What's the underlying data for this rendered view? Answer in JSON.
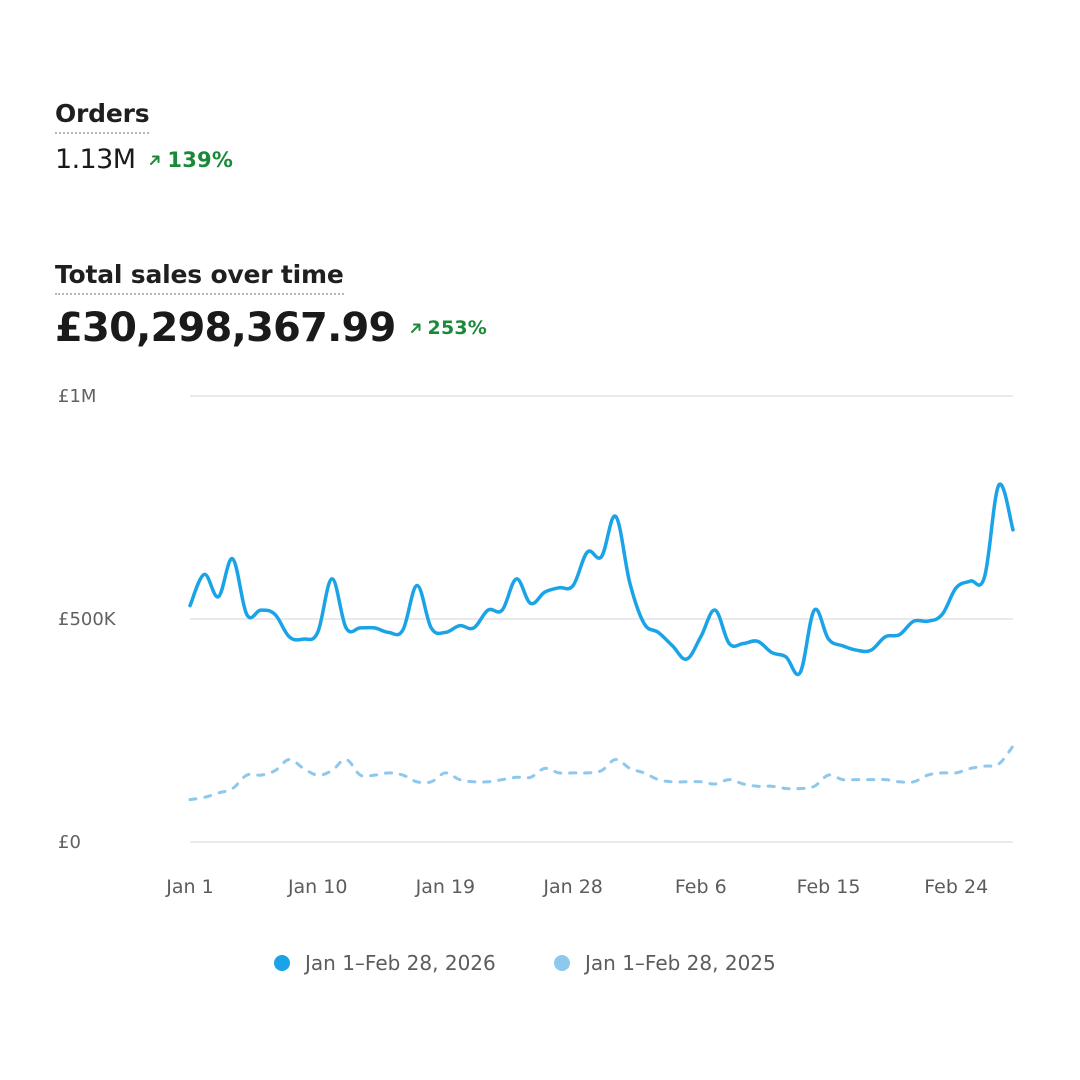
{
  "orders": {
    "label": "Orders",
    "value": "1.13M",
    "change": "139%",
    "trend_color": "#1a8a3a"
  },
  "sales": {
    "label": "Total sales over time",
    "value": "£30,298,367.99",
    "change": "253%",
    "trend_color": "#1a8a3a"
  },
  "chart_data": {
    "type": "line",
    "title": "Total sales over time",
    "y_ticks": [
      "£0",
      "£500K",
      "£1M"
    ],
    "ylim": [
      0,
      1000000
    ],
    "x_tick_labels": [
      "Jan 1",
      "Jan 10",
      "Jan 19",
      "Jan 28",
      "Feb 6",
      "Feb 15",
      "Feb 24"
    ],
    "x_tick_days": [
      1,
      10,
      19,
      28,
      37,
      46,
      55
    ],
    "grid": true,
    "legend_position": "bottom",
    "series": [
      {
        "name": "Jan 1–Feb 28, 2026",
        "color": "#1ba3e8",
        "style": "solid",
        "days": [
          1,
          2,
          3,
          4,
          5,
          6,
          7,
          8,
          9,
          10,
          11,
          12,
          13,
          14,
          15,
          16,
          17,
          18,
          19,
          20,
          21,
          22,
          23,
          24,
          25,
          26,
          27,
          28,
          29,
          30,
          31,
          32,
          33,
          34,
          35,
          36,
          37,
          38,
          39,
          40,
          41,
          42,
          43,
          44,
          45,
          46,
          47,
          48,
          49,
          50,
          51,
          52,
          53,
          54,
          55,
          56,
          57,
          58,
          59
        ],
        "values": [
          530000,
          600000,
          550000,
          635000,
          510000,
          520000,
          510000,
          460000,
          455000,
          470000,
          590000,
          480000,
          480000,
          480000,
          470000,
          475000,
          575000,
          480000,
          470000,
          485000,
          480000,
          520000,
          520000,
          590000,
          535000,
          560000,
          570000,
          575000,
          650000,
          640000,
          730000,
          580000,
          490000,
          470000,
          440000,
          410000,
          460000,
          520000,
          445000,
          445000,
          450000,
          425000,
          415000,
          380000,
          520000,
          455000,
          440000,
          430000,
          430000,
          460000,
          465000,
          495000,
          495000,
          510000,
          570000,
          585000,
          595000,
          800000,
          700000
        ]
      },
      {
        "name": "Jan 1–Feb 28, 2025",
        "color": "#8ec8ec",
        "style": "dashed",
        "days": [
          1,
          2,
          3,
          4,
          5,
          6,
          7,
          8,
          9,
          10,
          11,
          12,
          13,
          14,
          15,
          16,
          17,
          18,
          19,
          20,
          21,
          22,
          23,
          24,
          25,
          26,
          27,
          28,
          29,
          30,
          31,
          32,
          33,
          34,
          35,
          36,
          37,
          38,
          39,
          40,
          41,
          42,
          43,
          44,
          45,
          46,
          47,
          48,
          49,
          50,
          51,
          52,
          53,
          54,
          55,
          56,
          57,
          58,
          59
        ],
        "values": [
          95000,
          100000,
          110000,
          120000,
          150000,
          150000,
          160000,
          185000,
          165000,
          150000,
          160000,
          185000,
          150000,
          150000,
          155000,
          150000,
          135000,
          135000,
          155000,
          140000,
          135000,
          135000,
          140000,
          145000,
          145000,
          165000,
          155000,
          155000,
          155000,
          160000,
          185000,
          165000,
          155000,
          140000,
          135000,
          135000,
          135000,
          130000,
          140000,
          130000,
          125000,
          125000,
          120000,
          120000,
          125000,
          150000,
          140000,
          140000,
          140000,
          140000,
          135000,
          135000,
          150000,
          155000,
          155000,
          165000,
          170000,
          175000,
          215000
        ]
      }
    ]
  }
}
